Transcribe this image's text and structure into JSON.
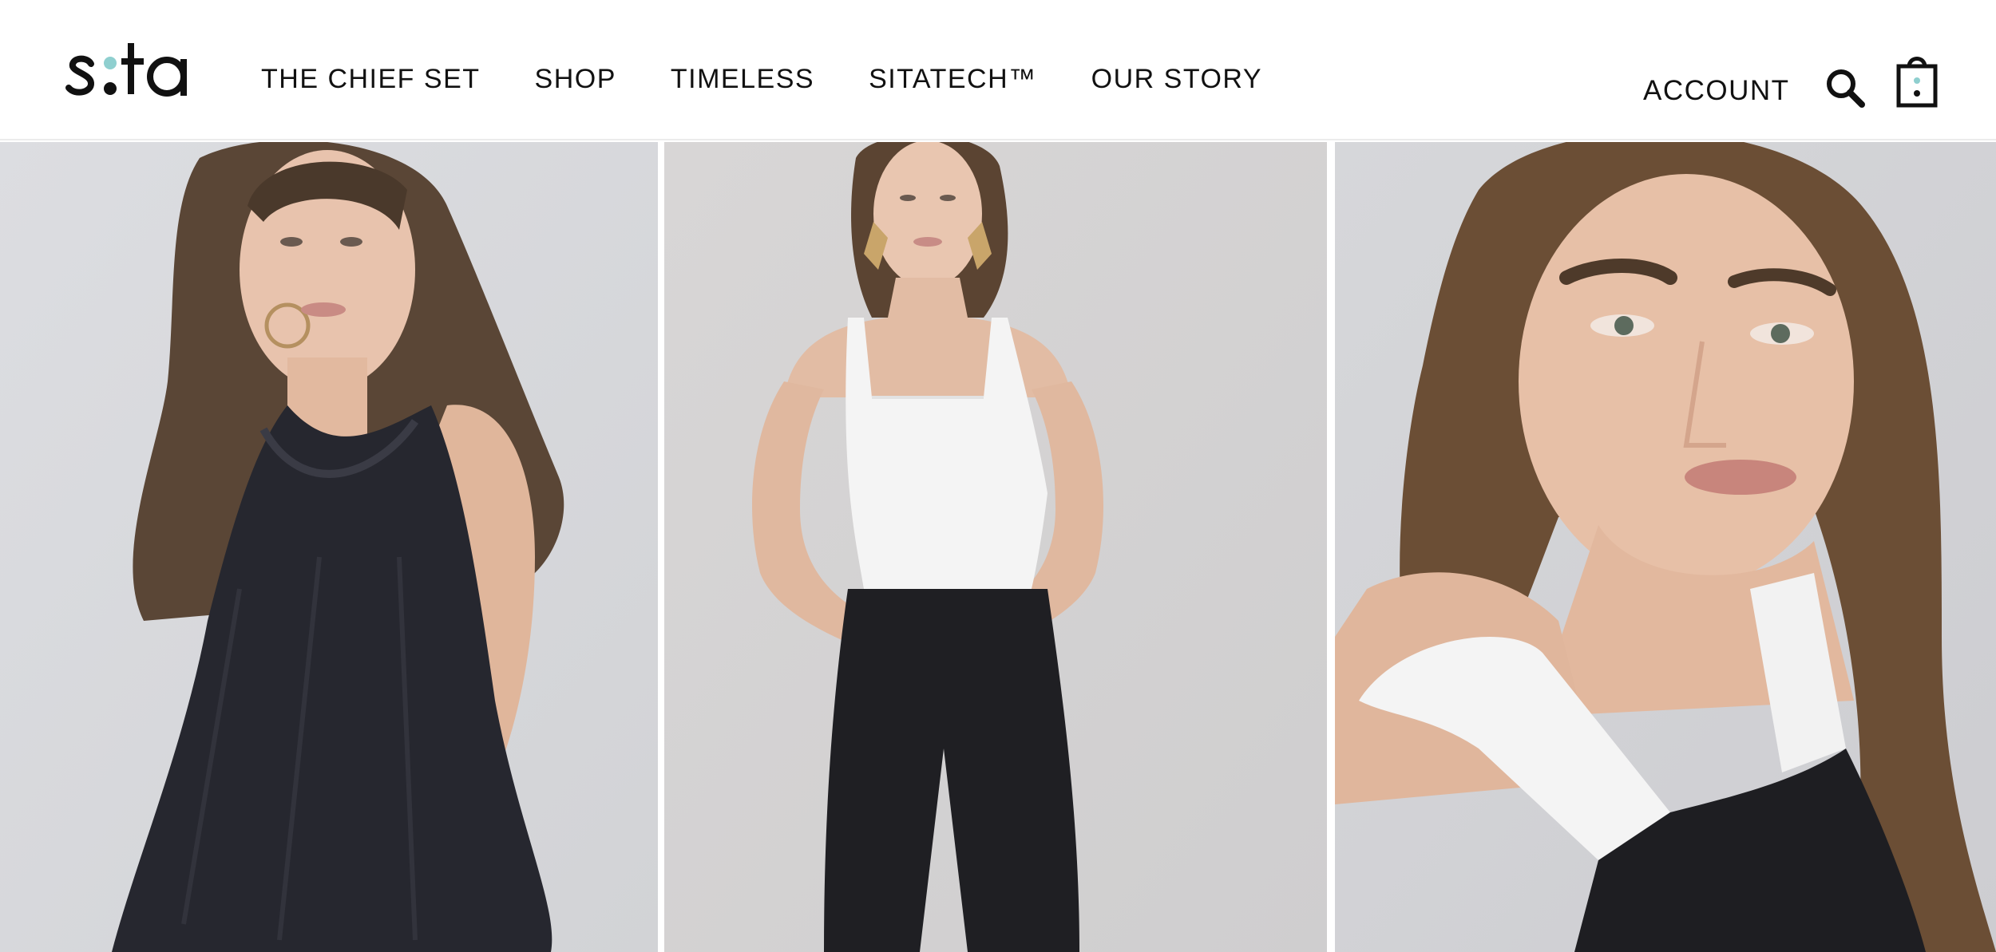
{
  "brand": {
    "name": "sita",
    "text_color": "#111111",
    "dot_color": "#8fcfcf"
  },
  "nav": {
    "items": [
      {
        "label": "THE CHIEF SET"
      },
      {
        "label": "SHOP"
      },
      {
        "label": "TIMELESS"
      },
      {
        "label": "SITATECH™"
      },
      {
        "label": "OUR STORY"
      }
    ]
  },
  "header_right": {
    "account_label": "ACCOUNT",
    "search_icon": "search-icon",
    "bag_icon": "shopping-bag-icon"
  },
  "gallery": {
    "panels": [
      {
        "subject": "model-black-sleeveless-ruffle-top"
      },
      {
        "subject": "model-white-tank-black-pants"
      },
      {
        "subject": "model-closeup-white-strap-black-top"
      }
    ]
  }
}
